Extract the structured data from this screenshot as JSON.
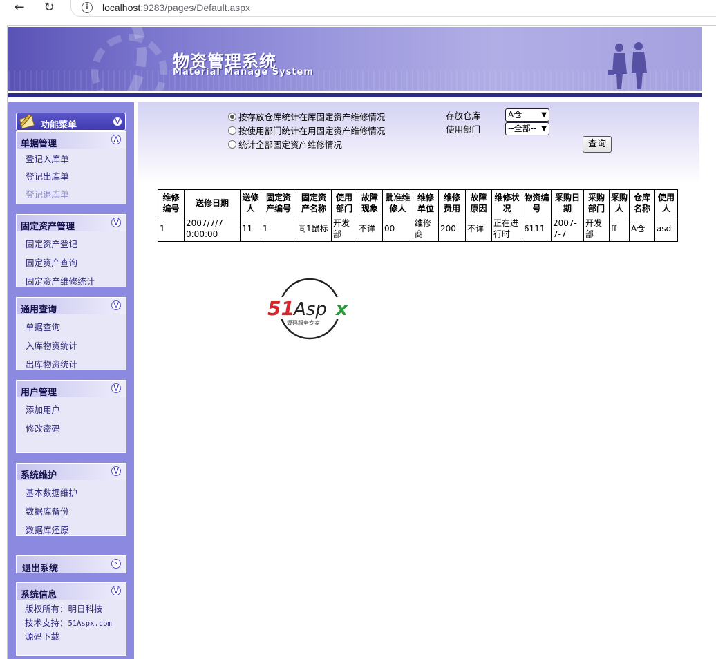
{
  "browser": {
    "url_host": "localhost",
    "url_rest": ":9283/pages/Default.aspx"
  },
  "banner": {
    "title": "物资管理系统",
    "subtitle": "Material Manage System"
  },
  "sidebar": {
    "menu_title": "功能菜单",
    "panels": [
      {
        "title": "单据管理",
        "items": [
          "登记入库单",
          "登记出库单",
          "登记退库单"
        ]
      },
      {
        "title": "固定资产管理",
        "items": [
          "固定资产登记",
          "固定资产查询",
          "固定资产维修统计"
        ]
      },
      {
        "title": "通用查询",
        "items": [
          "单据查询",
          "入库物资统计",
          "出库物资统计"
        ]
      },
      {
        "title": "用户管理",
        "items": [
          "添加用户",
          "修改密码"
        ]
      },
      {
        "title": "系统维护",
        "items": [
          "基本数据维护",
          "数据库备份",
          "数据库还原"
        ]
      }
    ],
    "logout": "退出系统",
    "info": {
      "title": "系统信息",
      "lines": [
        "版权所有：明日科技",
        "技术支持：51Aspx.com",
        "源码下载"
      ]
    }
  },
  "query": {
    "options": [
      "按存放仓库统计在库固定资产维修情况",
      "按使用部门统计在用固定资产维修情况",
      "统计全部固定资产维修情况"
    ],
    "selected_option": 0,
    "warehouse_label": "存放仓库",
    "warehouse_value": "A仓",
    "dept_label": "使用部门",
    "dept_value": "--全部--",
    "button": "查询"
  },
  "table": {
    "headers": [
      "维修编号",
      "送修日期",
      "送修人",
      "固定资产编号",
      "固定资产名称",
      "使用部门",
      "故障现象",
      "批准维修人",
      "维修单位",
      "维修费用",
      "故障原因",
      "维修状况",
      "物资编号",
      "采购日期",
      "采购部门",
      "采购人",
      "仓库名称",
      "使用人"
    ],
    "rows": [
      [
        "1",
        "2007/7/7 0:00:00",
        "11",
        "1",
        "同1鼠标",
        "开发部",
        "不详",
        "00",
        "维修商",
        "200",
        "不详",
        "正在进行时",
        "6111",
        "2007-7-7",
        "开发部",
        "ff",
        "A仓",
        "asd"
      ]
    ]
  },
  "logo": {
    "text": "51Aspx",
    "tagline": "源码服务专家"
  },
  "colors": {
    "sidebar_bg": "#8c89e0",
    "banner_dark": "#2b2a8a",
    "link": "#2b2778"
  }
}
